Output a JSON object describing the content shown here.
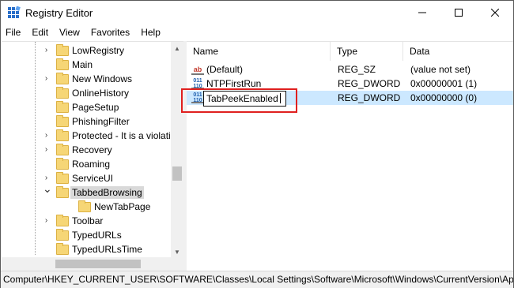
{
  "window": {
    "title": "Registry Editor",
    "min_icon": "minimize-icon",
    "max_icon": "maximize-icon",
    "close_icon": "close-icon"
  },
  "menu": [
    "File",
    "Edit",
    "View",
    "Favorites",
    "Help"
  ],
  "tree": {
    "items": [
      {
        "label": "LowRegistry",
        "expander": "chevron-right",
        "selected": false
      },
      {
        "label": "Main",
        "expander": "",
        "selected": false
      },
      {
        "label": "New Windows",
        "expander": "chevron-right",
        "selected": false
      },
      {
        "label": "OnlineHistory",
        "expander": "",
        "selected": false
      },
      {
        "label": "PageSetup",
        "expander": "",
        "selected": false
      },
      {
        "label": "PhishingFilter",
        "expander": "",
        "selected": false
      },
      {
        "label": "Protected - It is a violati",
        "expander": "chevron-right",
        "selected": false
      },
      {
        "label": "Recovery",
        "expander": "chevron-right",
        "selected": false
      },
      {
        "label": "Roaming",
        "expander": "",
        "selected": false
      },
      {
        "label": "ServiceUI",
        "expander": "chevron-right",
        "selected": false
      },
      {
        "label": "TabbedBrowsing",
        "expander": "chevron-down",
        "selected": true
      },
      {
        "label": "NewTabPage",
        "expander": "",
        "selected": false,
        "child": true
      },
      {
        "label": "Toolbar",
        "expander": "chevron-right",
        "selected": false
      },
      {
        "label": "TypedURLs",
        "expander": "",
        "selected": false
      },
      {
        "label": "TypedURLsTime",
        "expander": "",
        "selected": false
      }
    ]
  },
  "list": {
    "columns": [
      "Name",
      "Type",
      "Data"
    ],
    "rows": [
      {
        "name": "(Default)",
        "type": "REG_SZ",
        "data": "(value not set)",
        "icon": "string-value-icon",
        "selected": false
      },
      {
        "name": "NTPFirstRun",
        "type": "REG_DWORD",
        "data": "0x00000001 (1)",
        "icon": "dword-value-icon",
        "selected": false
      },
      {
        "name": "",
        "type": "REG_DWORD",
        "data": "0x00000000 (0)",
        "icon": "dword-value-icon",
        "selected": true
      }
    ],
    "rename_value": "TabPeekEnabled"
  },
  "status_path": "Computer\\HKEY_CURRENT_USER\\SOFTWARE\\Classes\\Local Settings\\Software\\Microsoft\\Windows\\CurrentVersion\\Ap",
  "colors": {
    "highlight": "#e0201f",
    "selection": "#cce8ff"
  }
}
